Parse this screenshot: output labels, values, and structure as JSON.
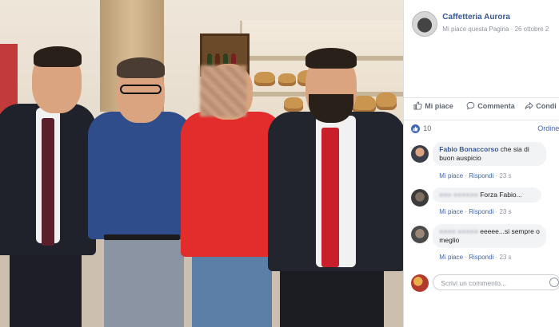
{
  "post": {
    "page_name": "Caffetteria Aurora",
    "like_page": "Mi piace questa Pagina",
    "separator": " · ",
    "date": "26 ottobre 2"
  },
  "actions": {
    "like": "Mi piace",
    "comment": "Commenta",
    "share": "Condi"
  },
  "reactions": {
    "count": "10",
    "order": "Ordine"
  },
  "comments": [
    {
      "author": "Fabio Bonaccorso",
      "text": " che sia di buon auspicio",
      "like": "Mi piace",
      "reply": "Rispondi",
      "time": "23 s"
    },
    {
      "author": "Forza Fabio",
      "text": "Forza Fabio...",
      "like": "Mi piace",
      "reply": "Rispondi",
      "time": "23 s"
    },
    {
      "author": "",
      "text": "eeeee...si sempre o meglio",
      "like": "Mi piace",
      "reply": "Rispondi",
      "time": "23 s"
    }
  ],
  "composer": {
    "placeholder": "Scrivi un commento..."
  },
  "colors": {
    "fb_blue": "#4267b2",
    "link": "#365899",
    "red_shirt": "#e32c2c"
  }
}
